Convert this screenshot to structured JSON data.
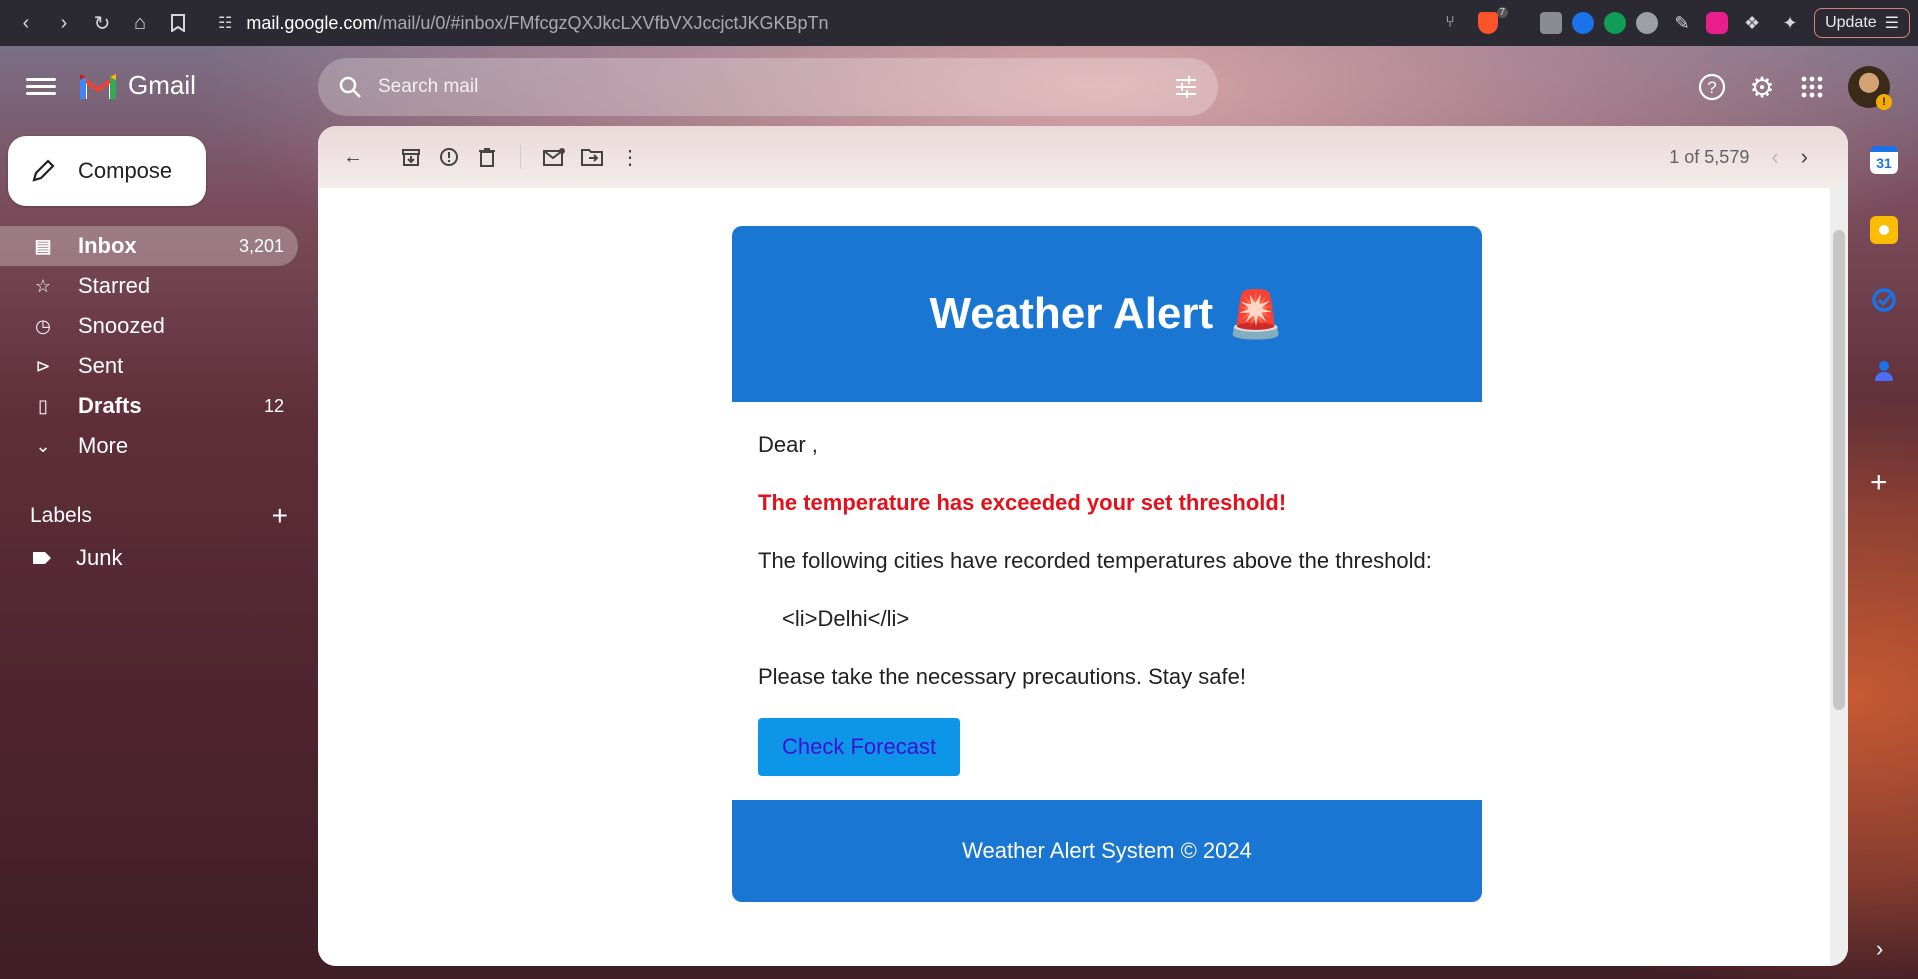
{
  "browser": {
    "url_host": "mail.google.com",
    "url_path": "/mail/u/0/#inbox/FMfcgzQXJkcLXVfbVXJccjctJKGKBpTn",
    "update_label": "Update",
    "brave_badge": "7"
  },
  "header": {
    "app_name": "Gmail",
    "search_placeholder": "Search mail"
  },
  "sidebar": {
    "compose_label": "Compose",
    "items": [
      {
        "label": "Inbox",
        "count": "3,201",
        "icon": "inbox-icon"
      },
      {
        "label": "Starred",
        "count": "",
        "icon": "star-icon"
      },
      {
        "label": "Snoozed",
        "count": "",
        "icon": "clock-icon"
      },
      {
        "label": "Sent",
        "count": "",
        "icon": "send-icon"
      },
      {
        "label": "Drafts",
        "count": "12",
        "icon": "draft-icon"
      },
      {
        "label": "More",
        "count": "",
        "icon": "chevron-down-icon"
      }
    ],
    "labels_heading": "Labels",
    "labels": [
      {
        "label": "Junk",
        "icon": "label-icon"
      }
    ]
  },
  "toolbar": {
    "pager_text": "1 of 5,579"
  },
  "email": {
    "title": "Weather Alert",
    "title_emoji": "🚨",
    "greeting": "Dear ,",
    "alert_line": "The temperature has exceeded your set threshold!",
    "intro_line": "The following cities have recorded temperatures above the threshold:",
    "city_line": "<li>Delhi</li>",
    "closing_line": "Please take the necessary precautions. Stay safe!",
    "cta_label": "Check Forecast",
    "footer": "Weather Alert System © 2024"
  },
  "rail": {
    "calendar_day": "31"
  },
  "colors": {
    "email_header": "#1976d2",
    "alert_text": "#e3111c",
    "cta_bg": "#0d95e8",
    "cta_text": "#3d10d4"
  }
}
